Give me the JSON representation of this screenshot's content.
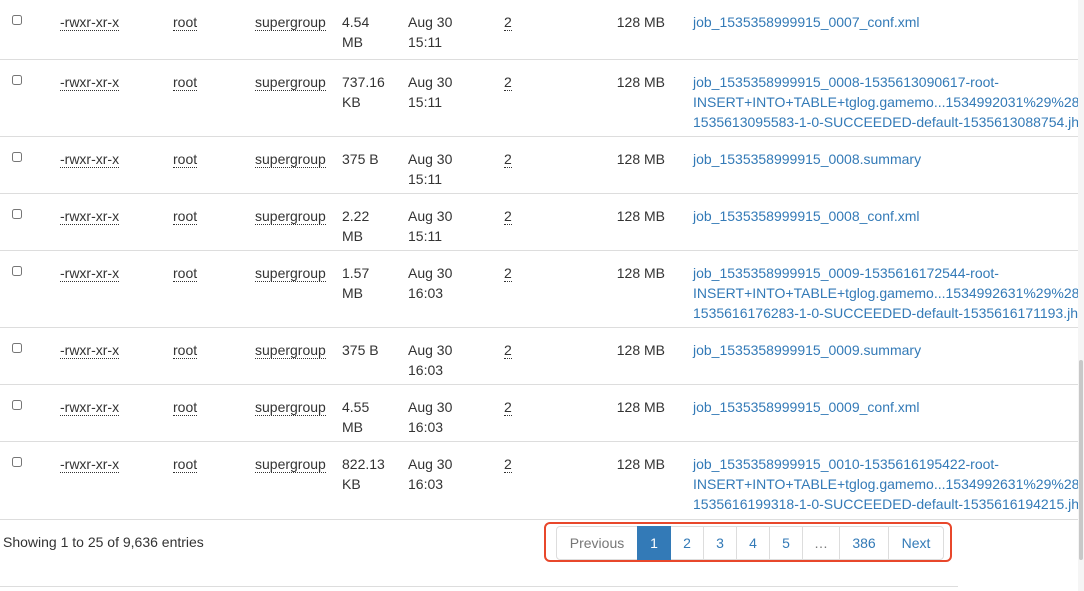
{
  "rows": [
    {
      "perm": "-rwxr-xr-x",
      "owner": "root",
      "group": "supergroup",
      "size": [
        "4.54",
        "MB"
      ],
      "date": [
        "Aug 30",
        "15:11"
      ],
      "replication": "2",
      "block_size": "128 MB",
      "name": [
        "job_1535358999915_0007_conf.xml"
      ]
    },
    {
      "perm": "-rwxr-xr-x",
      "owner": "root",
      "group": "supergroup",
      "size": [
        "737.16",
        "KB"
      ],
      "date": [
        "Aug 30",
        "15:11"
      ],
      "replication": "2",
      "block_size": "128 MB",
      "name": [
        "job_1535358999915_0008-1535613090617-root-",
        "INSERT+INTO+TABLE+tglog.gamemo...1534992031%29%28",
        "1535613095583-1-0-SUCCEEDED-default-1535613088754.jh"
      ]
    },
    {
      "perm": "-rwxr-xr-x",
      "owner": "root",
      "group": "supergroup",
      "size": [
        "375 B"
      ],
      "date": [
        "Aug 30",
        "15:11"
      ],
      "replication": "2",
      "block_size": "128 MB",
      "name": [
        "job_1535358999915_0008.summary"
      ]
    },
    {
      "perm": "-rwxr-xr-x",
      "owner": "root",
      "group": "supergroup",
      "size": [
        "2.22",
        "MB"
      ],
      "date": [
        "Aug 30",
        "15:11"
      ],
      "replication": "2",
      "block_size": "128 MB",
      "name": [
        "job_1535358999915_0008_conf.xml"
      ]
    },
    {
      "perm": "-rwxr-xr-x",
      "owner": "root",
      "group": "supergroup",
      "size": [
        "1.57",
        "MB"
      ],
      "date": [
        "Aug 30",
        "16:03"
      ],
      "replication": "2",
      "block_size": "128 MB",
      "name": [
        "job_1535358999915_0009-1535616172544-root-",
        "INSERT+INTO+TABLE+tglog.gamemo...1534992631%29%28",
        "1535616176283-1-0-SUCCEEDED-default-1535616171193.jh"
      ]
    },
    {
      "perm": "-rwxr-xr-x",
      "owner": "root",
      "group": "supergroup",
      "size": [
        "375 B"
      ],
      "date": [
        "Aug 30",
        "16:03"
      ],
      "replication": "2",
      "block_size": "128 MB",
      "name": [
        "job_1535358999915_0009.summary"
      ]
    },
    {
      "perm": "-rwxr-xr-x",
      "owner": "root",
      "group": "supergroup",
      "size": [
        "4.55",
        "MB"
      ],
      "date": [
        "Aug 30",
        "16:03"
      ],
      "replication": "2",
      "block_size": "128 MB",
      "name": [
        "job_1535358999915_0009_conf.xml"
      ]
    },
    {
      "perm": "-rwxr-xr-x",
      "owner": "root",
      "group": "supergroup",
      "size": [
        "822.13",
        "KB"
      ],
      "date": [
        "Aug 30",
        "16:03"
      ],
      "replication": "2",
      "block_size": "128 MB",
      "name": [
        "job_1535358999915_0010-1535616195422-root-",
        "INSERT+INTO+TABLE+tglog.gamemo...1534992631%29%28",
        "1535616199318-1-0-SUCCEEDED-default-1535616194215.jh"
      ]
    }
  ],
  "table_info": "Showing 1 to 25 of 9,636 entries",
  "pagination": {
    "previous": "Previous",
    "pages": [
      "1",
      "2",
      "3",
      "4",
      "5",
      "…",
      "386"
    ],
    "active_page": "1",
    "next": "Next"
  },
  "colors": {
    "link": "#337ab7",
    "active_page_bg": "#337ab7",
    "highlight_border": "#e8472b"
  }
}
